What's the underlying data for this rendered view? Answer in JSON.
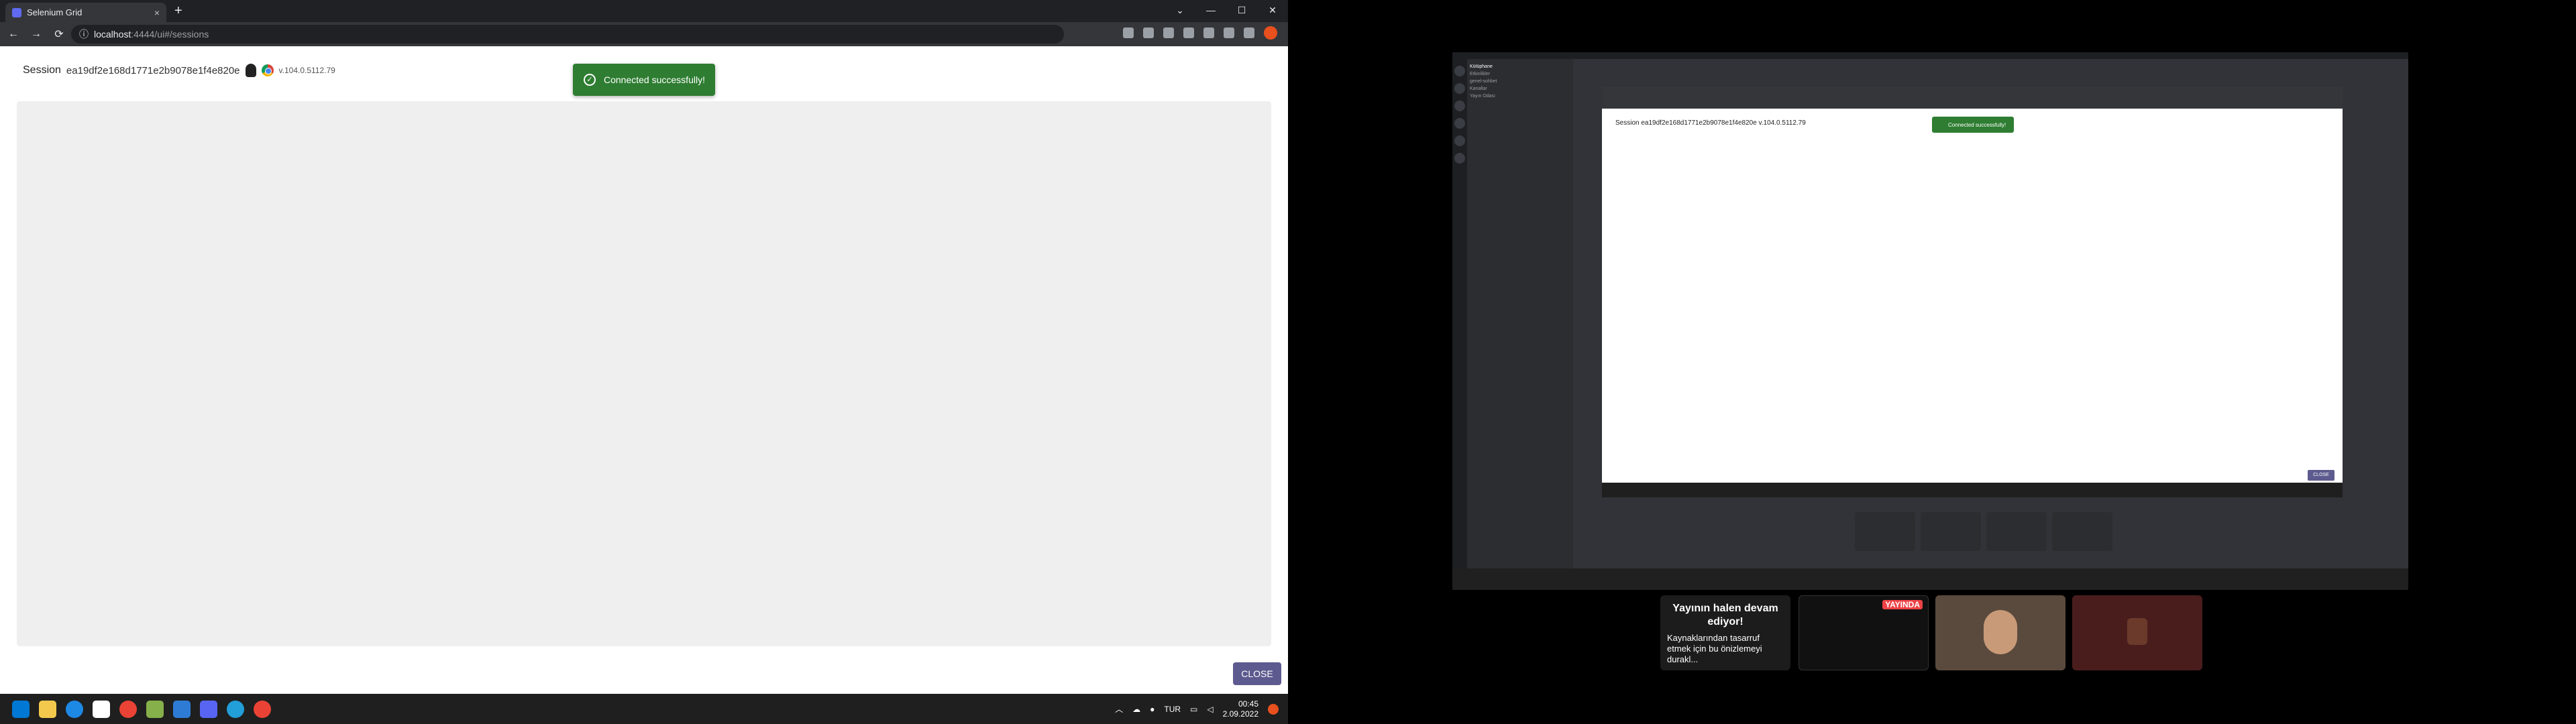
{
  "browser": {
    "tab_title": "Selenium Grid",
    "tab_close": "×",
    "new_tab": "+",
    "url_host": "localhost",
    "url_path": ":4444/ui#/sessions",
    "back": "←",
    "forward": "→",
    "reload": "⟳",
    "window_controls": [
      "⌄",
      "—",
      "☐",
      "✕"
    ]
  },
  "session": {
    "label": "Session",
    "id": "ea19df2e168d1771e2b9078e1f4e820e",
    "version": "v.104.0.5112.79"
  },
  "toast": {
    "message": "Connected successfully!"
  },
  "close_button": "CLOSE",
  "taskbar": {
    "lang": "TUR",
    "time": "00:45",
    "date": "2.09.2022",
    "chevron": "︿"
  },
  "right": {
    "nested_session_label": "Session",
    "nested_session_id": "ea19df2e168d1771e2b9078e1f4e820e",
    "nested_version": "v.104.0.5112.79",
    "nested_toast": "Connected successfully!",
    "nested_close": "CLOSE",
    "server_name": "Kütüphane",
    "channel_rows": [
      "Etkinlikler",
      "genel-sohbet",
      "Kanallar",
      "Yayın Odası"
    ],
    "preview_title": "Yayının halen devam ediyor!",
    "preview_text": "Kaynaklarından tasarruf etmek için bu önizlemeyi durakl...",
    "live_label": "YAYINDA"
  }
}
